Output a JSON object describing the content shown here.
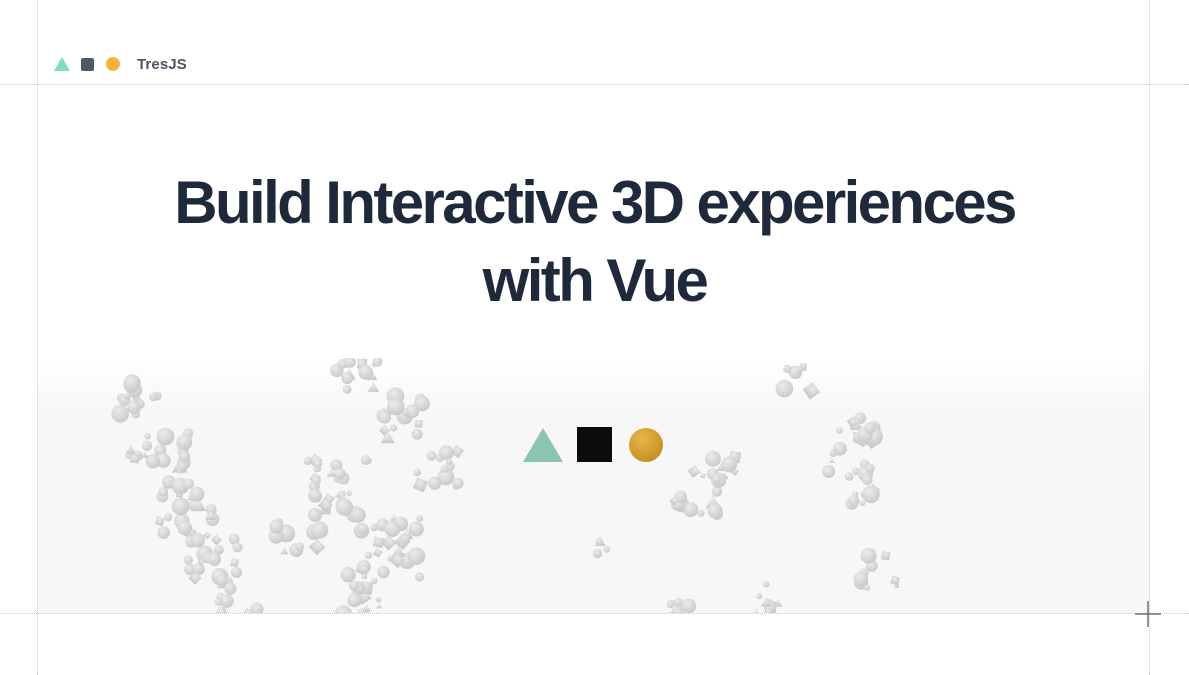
{
  "brand": {
    "name": "TresJS",
    "logo_icons": [
      "triangle-icon",
      "square-icon",
      "circle-icon"
    ],
    "colors": {
      "triangle": "#82dbc5",
      "square": "#4f5a66",
      "circle": "#fbb03b"
    }
  },
  "hero": {
    "title_line1": "Build Interactive 3D experiences",
    "title_line2": "with Vue",
    "title_color": "#1e293b"
  },
  "scene": {
    "background": "#f7f7f7",
    "particle_color": "#d6d6d6",
    "shapes": [
      "triangle",
      "cube",
      "sphere"
    ],
    "shape_colors": {
      "triangle": "#8bc4b2",
      "cube": "#0c0c0c",
      "sphere": "#d9a22e"
    }
  },
  "icons": {
    "corner_marker": "plus-icon"
  }
}
